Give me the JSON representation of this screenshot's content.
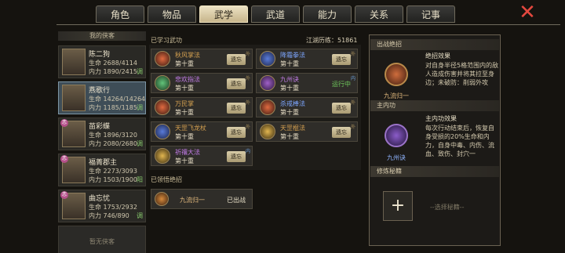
{
  "tabs": [
    {
      "label": "角色",
      "active": false,
      "notify": false
    },
    {
      "label": "物品",
      "active": false,
      "notify": true
    },
    {
      "label": "武学",
      "active": true,
      "notify": false
    },
    {
      "label": "武道",
      "active": false,
      "notify": false
    },
    {
      "label": "能力",
      "active": false,
      "notify": false
    },
    {
      "label": "关系",
      "active": false,
      "notify": false
    },
    {
      "label": "记事",
      "active": false,
      "notify": false
    }
  ],
  "close_icon": "✕",
  "heroes_title": "我的侠客",
  "heroes": [
    {
      "name": "陈二狗",
      "hp": "生命 2688/4114",
      "mp": "内力 1890/2415",
      "tag": "调",
      "badge": ""
    },
    {
      "name": "燕歌行",
      "hp": "生命 14264/14264",
      "mp": "内力 1185/1185",
      "tag": "调",
      "badge": ""
    },
    {
      "name": "苗彩蝶",
      "hp": "生命 1896/3120",
      "mp": "内力 2080/2680",
      "tag": "调",
      "badge": "恋"
    },
    {
      "name": "福菁郡主",
      "hp": "生命 2273/3093",
      "mp": "内力 1503/1900",
      "tag": "阳",
      "badge": "恋"
    },
    {
      "name": "曲忘忧",
      "hp": "生命 1753/2932",
      "mp": "内力 746/890",
      "tag": "调",
      "badge": "恋"
    }
  ],
  "no_more_heroes": "暂无侠客",
  "learned_label": "已学习武功",
  "experience": "江湖历练：51861",
  "skills": [
    {
      "name": "秋风掌法",
      "level": "第十重",
      "action": "遗忘",
      "status": "",
      "mark": "外",
      "color": "gold",
      "icon": "red"
    },
    {
      "name": "降霜拳法",
      "level": "第十重",
      "action": "遗忘",
      "status": "",
      "mark": "外",
      "color": "blue",
      "icon": "blue"
    },
    {
      "name": "悲欢指法",
      "level": "第十重",
      "action": "遗忘",
      "status": "",
      "mark": "外",
      "color": "purple",
      "icon": "green"
    },
    {
      "name": "九州诀",
      "level": "第十重",
      "action": "",
      "status": "运行中",
      "mark": "内",
      "color": "purple",
      "icon": "purple"
    },
    {
      "name": "万民掌",
      "level": "第十重",
      "action": "遗忘",
      "status": "",
      "mark": "外",
      "color": "gold",
      "icon": "red"
    },
    {
      "name": "杀戒棒法",
      "level": "第十重",
      "action": "遗忘",
      "status": "",
      "mark": "外",
      "color": "blue",
      "icon": "red"
    },
    {
      "name": "天罡飞龙杖",
      "level": "第十重",
      "action": "遗忘",
      "status": "",
      "mark": "外",
      "color": "gold",
      "icon": "blue"
    },
    {
      "name": "天罡棍法",
      "level": "第十重",
      "action": "遗忘",
      "status": "",
      "mark": "外",
      "color": "gold",
      "icon": "gold"
    },
    {
      "name": "祈禳大法",
      "level": "第十重",
      "action": "遗忘",
      "status": "",
      "mark": "内",
      "color": "purple",
      "icon": "gold"
    }
  ],
  "realized_label": "已领悟绝招",
  "ultimate": {
    "name": "九流归一",
    "status": "已出战"
  },
  "right": {
    "battle_header": "出战绝招",
    "battle_icon_name": "九流归一",
    "battle_effect_title": "绝招效果",
    "battle_effect_desc": "对自身半径5格范围内的敌人造成伤害并将其拉至身边；未破防：削弱外攻",
    "inner_header": "主内功",
    "inner_icon_name": "九州诀",
    "inner_effect_title": "主内功效果",
    "inner_effect_desc": "每次行动结束后，恢复自身受损的20%生命和内力，自身中毒、内伤、流血、致伤、封穴一",
    "cultivation_header": "修炼秘籍",
    "add_label": "+",
    "select_hint": "--选择秘籍--"
  }
}
